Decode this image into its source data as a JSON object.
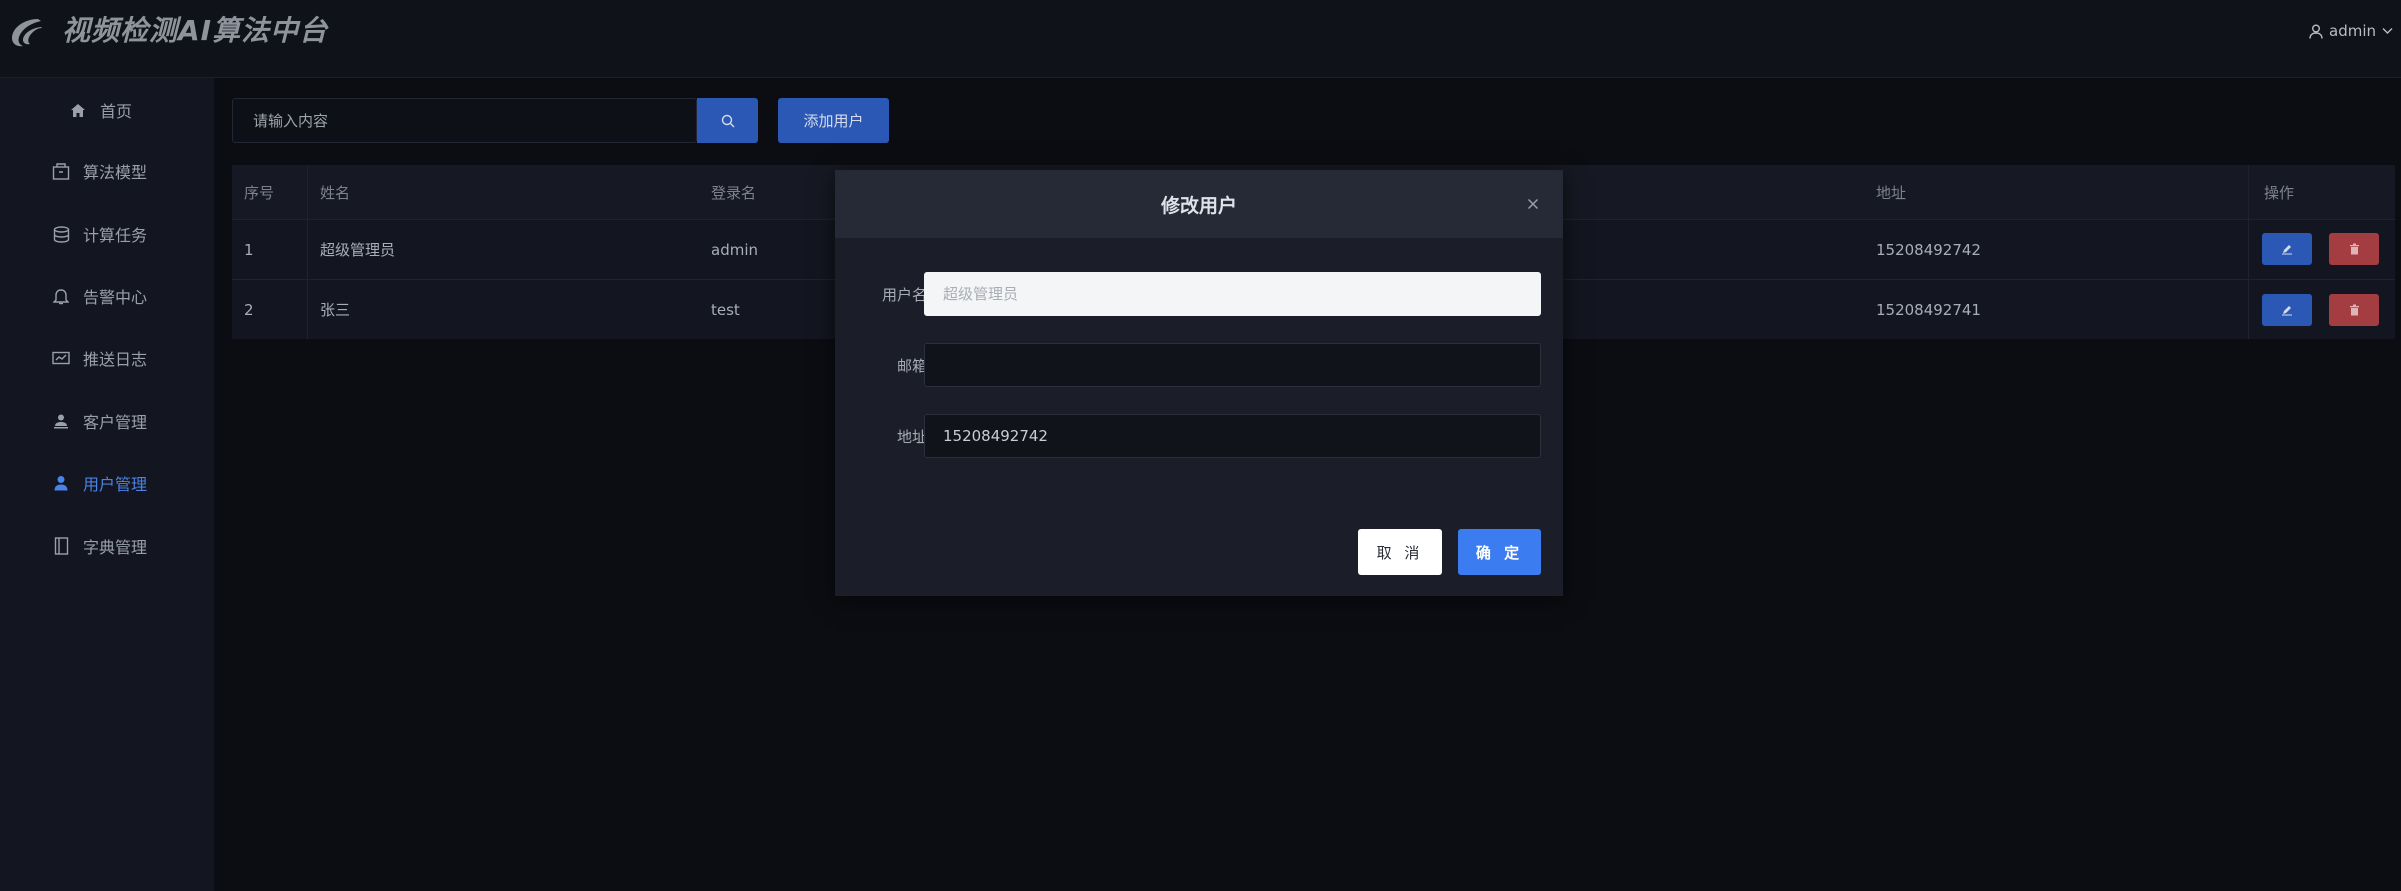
{
  "app": {
    "title": "视频检测AI算法中台",
    "user": "admin"
  },
  "colors": {
    "accent": "#2c58b5",
    "active_nav": "#4a83e6",
    "danger": "#a33d42",
    "primary_button": "#3b7cf0"
  },
  "sidebar": {
    "items": [
      {
        "label": "首页",
        "icon": "home-icon"
      },
      {
        "label": "算法模型",
        "icon": "box-icon"
      },
      {
        "label": "计算任务",
        "icon": "database-icon"
      },
      {
        "label": "告警中心",
        "icon": "bell-icon"
      },
      {
        "label": "推送日志",
        "icon": "monitor-icon"
      },
      {
        "label": "客户管理",
        "icon": "customer-icon"
      },
      {
        "label": "用户管理",
        "icon": "user-icon",
        "active": true
      },
      {
        "label": "字典管理",
        "icon": "book-icon"
      }
    ]
  },
  "toolbar": {
    "search_placeholder": "请输入内容",
    "search_icon": "search-icon",
    "add_label": "添加用户"
  },
  "table": {
    "columns": {
      "index": "序号",
      "name": "姓名",
      "login": "登录名",
      "address": "地址",
      "actions": "操作"
    },
    "rows": [
      {
        "index": "1",
        "name": "超级管理员",
        "login": "admin",
        "address": "15208492742"
      },
      {
        "index": "2",
        "name": "张三",
        "login": "test",
        "address": "15208492741"
      }
    ]
  },
  "dialog": {
    "title": "修改用户",
    "fields": {
      "username_label": "用户名",
      "username_placeholder": "超级管理员",
      "email_label": "邮箱",
      "email_value": "",
      "address_label": "地址",
      "address_value": "15208492742"
    },
    "cancel_label": "取 消",
    "confirm_label": "确 定"
  }
}
